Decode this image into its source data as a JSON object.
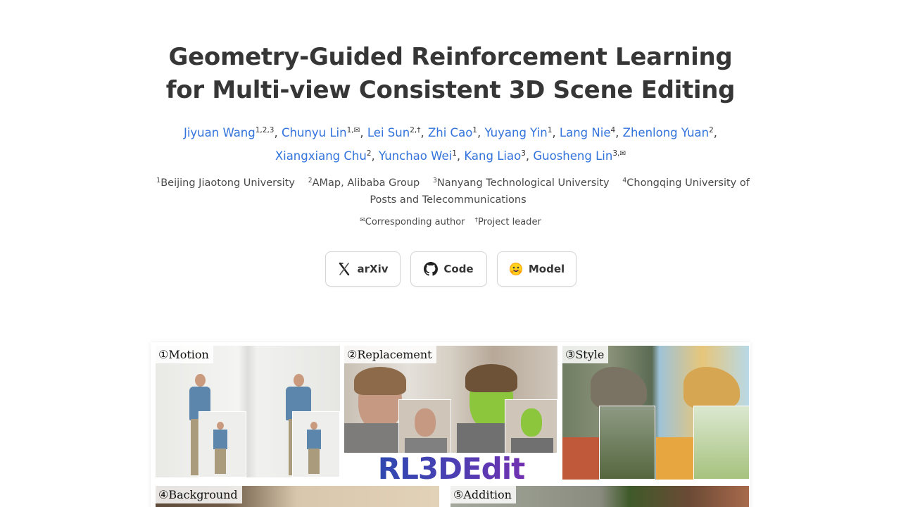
{
  "title": {
    "line1": "Geometry-Guided Reinforcement Learning",
    "line2": "for Multi-view Consistent 3D Scene Editing"
  },
  "authors": [
    {
      "name": "Jiyuan Wang",
      "sup": "1,2,3",
      "sep": ", "
    },
    {
      "name": "Chunyu Lin",
      "sup": "1,✉",
      "sep": ", "
    },
    {
      "name": "Lei Sun",
      "sup": "2,†",
      "sep": ", "
    },
    {
      "name": "Zhi Cao",
      "sup": "1",
      "sep": ", "
    },
    {
      "name": "Yuyang Yin",
      "sup": "1",
      "sep": ", "
    },
    {
      "name": "Lang Nie",
      "sup": "4",
      "sep": ", "
    },
    {
      "name": "Zhenlong Yuan",
      "sup": "2",
      "sep": ", "
    },
    {
      "name": "Xiangxiang Chu",
      "sup": "2",
      "sep": ", "
    },
    {
      "name": "Yunchao Wei",
      "sup": "1",
      "sep": ", "
    },
    {
      "name": "Kang Liao",
      "sup": "3",
      "sep": ", "
    },
    {
      "name": "Guosheng Lin",
      "sup": "3,✉",
      "sep": ""
    }
  ],
  "affiliations": [
    {
      "sup": "1",
      "name": "Beijing Jiaotong University"
    },
    {
      "sup": "2",
      "name": "AMap, Alibaba Group"
    },
    {
      "sup": "3",
      "name": "Nanyang Technological University"
    },
    {
      "sup": "4",
      "name": "Chongqing University of Posts and Telecommunications"
    }
  ],
  "notes": [
    {
      "sup": "✉",
      "text": "Corresponding author"
    },
    {
      "sup": "†",
      "text": "Project leader"
    }
  ],
  "buttons": {
    "arxiv": {
      "label": "arXiv",
      "icon": "arxiv-icon"
    },
    "code": {
      "label": "Code",
      "icon": "github-icon"
    },
    "model": {
      "label": "Model",
      "icon": "huggingface-icon",
      "emoji": "🤗"
    }
  },
  "teaser": {
    "motion": "①Motion",
    "replacement": "②Replacement",
    "style": "③Style",
    "background": "④Background",
    "addition": "⑤Addition",
    "logo": "RL3DEdit"
  },
  "colors": {
    "link": "#3273dc",
    "text": "#363636",
    "logo_gradient_start": "#2a4bb0",
    "logo_gradient_end": "#7a2fb0"
  }
}
